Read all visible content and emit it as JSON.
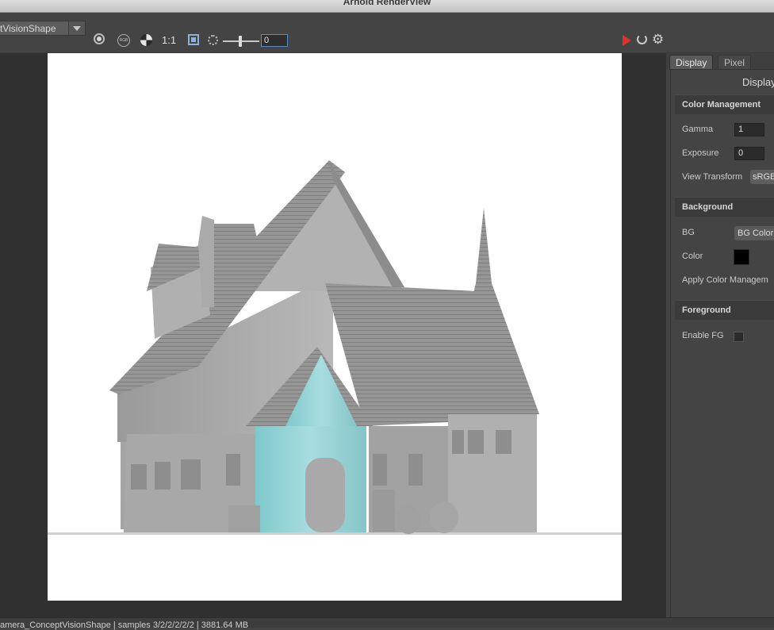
{
  "window": {
    "title": "Arnold RenderView"
  },
  "toolbar": {
    "camera_label": "tVisionShape",
    "zoom_label": "1:1",
    "icons": [
      "light-bulb-icon",
      "rgb-channel-icon",
      "display-toggle-icon",
      "frame-region-icon",
      "aperture-icon",
      "play-icon",
      "refresh-icon",
      "gear-icon"
    ],
    "exposure_slider_value": "0",
    "exposure_slider_level": 0.5,
    "accent_play_color": "#e0312b",
    "accent_region_color": "#8db2d6"
  },
  "panel": {
    "tabs": [
      {
        "label": "Display",
        "active": true
      },
      {
        "label": "Pixel",
        "active": false
      }
    ],
    "title": "Display",
    "color_management": {
      "header": "Color Management",
      "gamma_label": "Gamma",
      "gamma_value": "1",
      "exposure_label": "Exposure",
      "exposure_value": "0",
      "view_transform_label": "View Transform",
      "view_transform_value": "sRGB"
    },
    "background": {
      "header": "Background",
      "bg_label": "BG",
      "bg_value": "BG Color",
      "color_label": "Color",
      "color_value": "#000000",
      "apply_label": "Apply Color Managem"
    },
    "foreground": {
      "header": "Foreground",
      "enable_label": "Enable FG",
      "enable_checked": false
    }
  },
  "status": {
    "text": "amera_ConceptVisionShape  |  samples 3/2/2/2/2/2  |  3881.64 MB"
  }
}
